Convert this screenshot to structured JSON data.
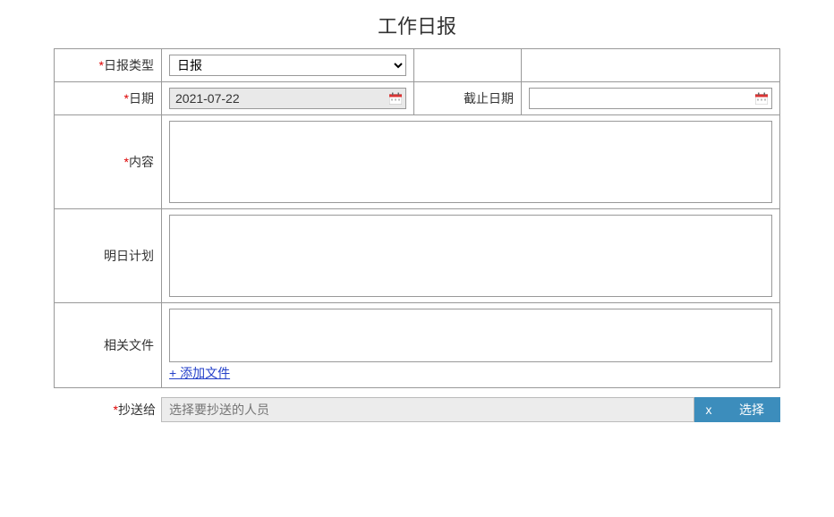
{
  "page_title": "工作日报",
  "labels": {
    "report_type": "日报类型",
    "date": "日期",
    "due_date": "截止日期",
    "content": "内容",
    "tomorrow_plan": "明日计划",
    "related_files": "相关文件",
    "cc": "抄送给"
  },
  "fields": {
    "report_type_selected": "日报",
    "date_value": "2021-07-22",
    "due_date_value": "",
    "content_value": "",
    "tomorrow_plan_value": "",
    "cc_placeholder": "选择要抄送的人员"
  },
  "actions": {
    "add_file": "+ 添加文件",
    "clear": "x",
    "select": "选择"
  },
  "required_mark": "*"
}
